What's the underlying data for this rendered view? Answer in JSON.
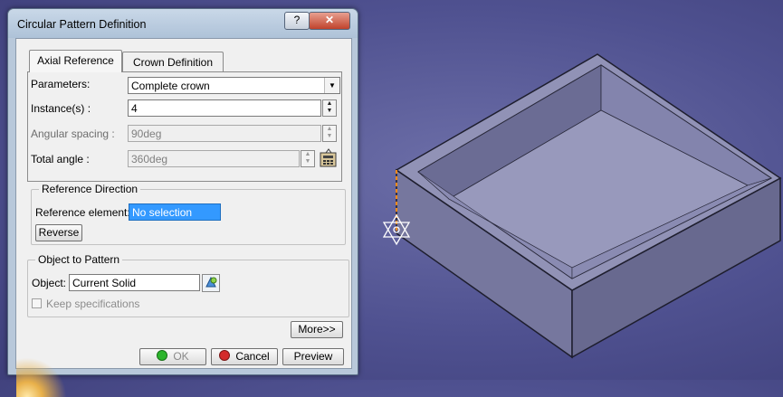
{
  "dialog": {
    "title": "Circular Pattern Definition",
    "help_label": "?",
    "close_label": "✕"
  },
  "tabs": [
    {
      "label": "Axial Reference"
    },
    {
      "label": "Crown Definition"
    }
  ],
  "parameters": {
    "parameters_label": "Parameters:",
    "parameters_value": "Complete crown",
    "instances_label": "Instance(s) :",
    "instances_value": "4",
    "angular_spacing_label": "Angular spacing :",
    "angular_spacing_value": "90deg",
    "total_angle_label": "Total angle :",
    "total_angle_value": "360deg"
  },
  "reference_direction": {
    "group_label": "Reference Direction",
    "element_label": "Reference element:",
    "element_value": "No selection",
    "reverse_label": "Reverse"
  },
  "object_to_pattern": {
    "group_label": "Object to Pattern",
    "object_label": "Object:",
    "object_value": "Current Solid",
    "keep_spec_label": "Keep specifications",
    "keep_spec_checked": false
  },
  "buttons": {
    "more_label": "More>>",
    "ok_label": "OK",
    "cancel_label": "Cancel",
    "preview_label": "Preview"
  },
  "colors": {
    "background": "#4f5190",
    "part_top": "#8f8fb2",
    "part_side": "#77779d",
    "selection": "#3399ff",
    "ok_dot": "#2db52d",
    "cancel_dot": "#d42b2b"
  }
}
